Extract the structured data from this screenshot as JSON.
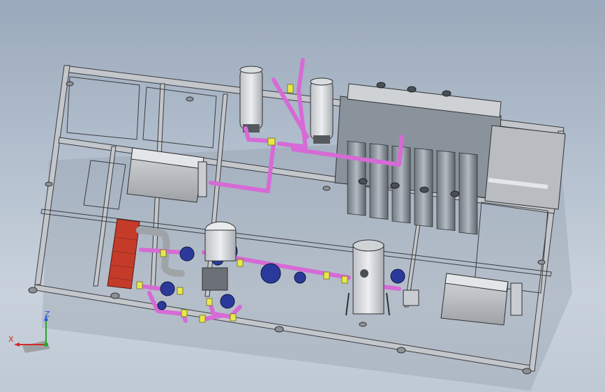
{
  "triad": {
    "x_label": "X",
    "y_label": "Y",
    "z_label": "Z"
  },
  "colors": {
    "background_top": "#9aa9bb",
    "background_bottom": "#c9d2dc",
    "frame": "#c3c6ca",
    "frame_edge": "#3a3c40",
    "pipe_magenta": "#d66ad6",
    "valve_blue": "#2b3a9a",
    "joint_yellow": "#e8e84a",
    "heat_exchanger_red": "#c43b2a",
    "axis_x": "#d22a2a",
    "axis_y": "#2aa52a",
    "axis_z": "#2a5ad6"
  },
  "icons": [
    "orientation-triad-icon"
  ]
}
